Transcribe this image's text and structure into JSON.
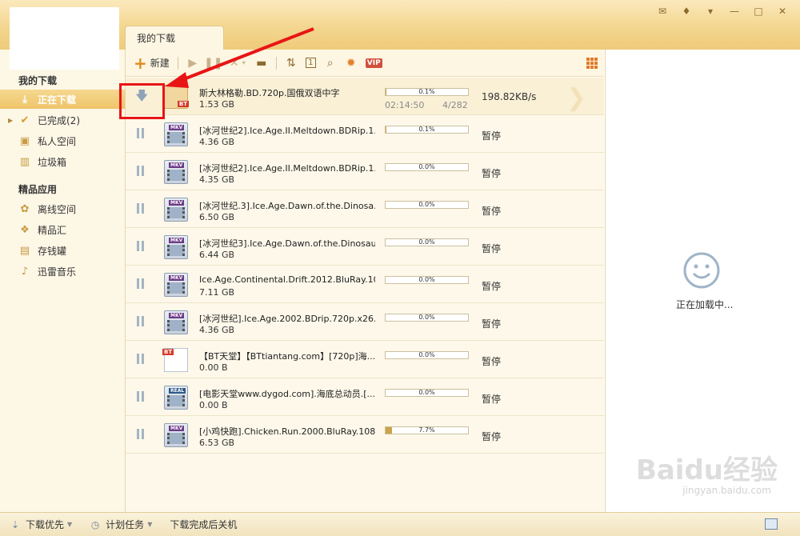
{
  "tab": {
    "label": "我的下载"
  },
  "toolbar": {
    "new_label": "新建",
    "vip_label": "VIP"
  },
  "sidebar": {
    "section1": "我的下载",
    "items1": [
      {
        "label": "正在下载",
        "icon": "download-icon"
      },
      {
        "label": "已完成(2)",
        "icon": "check-icon"
      },
      {
        "label": "私人空间",
        "icon": "lock-icon"
      },
      {
        "label": "垃圾箱",
        "icon": "trash-icon"
      }
    ],
    "section2": "精品应用",
    "items2": [
      {
        "label": "离线空间",
        "icon": "cloud-icon"
      },
      {
        "label": "精品汇",
        "icon": "gift-icon"
      },
      {
        "label": "存钱罐",
        "icon": "piggy-bank-icon"
      },
      {
        "label": "迅雷音乐",
        "icon": "music-icon"
      }
    ]
  },
  "downloads": [
    {
      "name": "斯大林格勒.BD.720p.国俄双语中字",
      "size": "1.53 GB",
      "progress_text": "0.1%",
      "progress": 0.001,
      "status": "198.82KB/s",
      "eta": "02:14:50",
      "pieces": "4/282",
      "type": "BT"
    },
    {
      "name": "[冰河世纪2].Ice.Age.II.Meltdown.BDRip.1...",
      "size": "4.36 GB",
      "progress_text": "0.1%",
      "progress": 0.001,
      "status": "暂停",
      "type": "MKV"
    },
    {
      "name": "[冰河世纪2].Ice.Age.II.Meltdown.BDRip.1...",
      "size": "4.35 GB",
      "progress_text": "0.0%",
      "progress": 0.0,
      "status": "暂停",
      "type": "MKV"
    },
    {
      "name": "[冰河世纪.3].Ice.Age.Dawn.of.the.Dinosa...",
      "size": "6.50 GB",
      "progress_text": "0.0%",
      "progress": 0.0,
      "status": "暂停",
      "type": "MKV"
    },
    {
      "name": "[冰河世纪3].Ice.Age.Dawn.of.the.Dinosau...",
      "size": "6.44 GB",
      "progress_text": "0.0%",
      "progress": 0.0,
      "status": "暂停",
      "type": "MKV"
    },
    {
      "name": "Ice.Age.Continental.Drift.2012.BluRay.10...",
      "size": "7.11 GB",
      "progress_text": "0.0%",
      "progress": 0.0,
      "status": "暂停",
      "type": "MKV"
    },
    {
      "name": "[冰河世纪].Ice.Age.2002.BDrip.720p.x26...",
      "size": "4.36 GB",
      "progress_text": "0.0%",
      "progress": 0.0,
      "status": "暂停",
      "type": "MKV"
    },
    {
      "name": "【BT天堂】【BTtiantang.com】[720p]海...",
      "size": "0.00 B",
      "progress_text": "0.0%",
      "progress": 0.0,
      "status": "暂停",
      "type": "BTFILE"
    },
    {
      "name": "[电影天堂www.dygod.com].海底总动员.[...",
      "size": "0.00 B",
      "progress_text": "0.0%",
      "progress": 0.0,
      "status": "暂停",
      "type": "REAL"
    },
    {
      "name": "[小鸡快跑].Chicken.Run.2000.BluRay.108...",
      "size": "6.53 GB",
      "progress_text": "7.7%",
      "progress": 0.077,
      "status": "暂停",
      "type": "MKV"
    }
  ],
  "right_panel": {
    "loading_text": "正在加载中..."
  },
  "statusbar": {
    "priority_label": "下载优先",
    "schedule_label": "计划任务",
    "shutdown_label": "下载完成后关机"
  },
  "watermark": {
    "brand": "Baidu经验",
    "url": "jingyan.baidu.com"
  },
  "colors": {
    "accent": "#efcb7b",
    "highlight": "#e81515",
    "progress": "#c9a44a"
  }
}
